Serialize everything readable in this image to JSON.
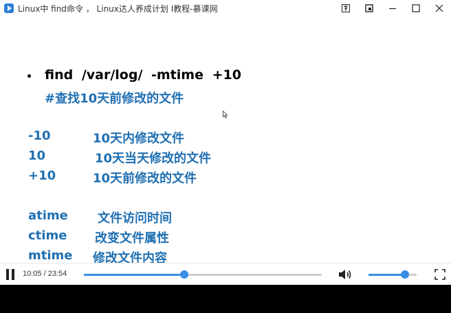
{
  "window": {
    "title": "Linux中 find命令 ， Linux达人养成计划 I教程-慕课网",
    "icon": "video-player-icon"
  },
  "window_controls": {
    "pin_icon": "pin-icon",
    "mini_icon": "mini-mode-icon",
    "minimize_icon": "minimize-icon",
    "maximize_icon": "maximize-icon",
    "close_icon": "close-icon"
  },
  "slide": {
    "command": "find   /var/log/   -mtime  +10",
    "comment": "#查找10天前修改的文件",
    "mtime_values": [
      {
        "code": "-10",
        "desc": "10天内修改文件"
      },
      {
        "code": "10",
        "desc": "10天当天修改的文件"
      },
      {
        "code": "+10",
        "desc": "10天前修改的文件"
      }
    ],
    "time_types": [
      {
        "name": "atime",
        "desc": "文件访问时间"
      },
      {
        "name": "ctime",
        "desc": "改变文件属性"
      },
      {
        "name": "mtime",
        "desc": "修改文件内容"
      }
    ],
    "text_color": "#1f6fb2"
  },
  "player": {
    "current_time": "10:05",
    "total_time": "23:54",
    "time_display": "10:05 / 23:54",
    "progress_fraction": 0.4219,
    "volume_fraction": 0.76,
    "accent_color": "#3a8ee6",
    "play_state_icon": "pause-icon",
    "volume_icon": "volume-icon",
    "fullscreen_icon": "fullscreen-icon"
  }
}
